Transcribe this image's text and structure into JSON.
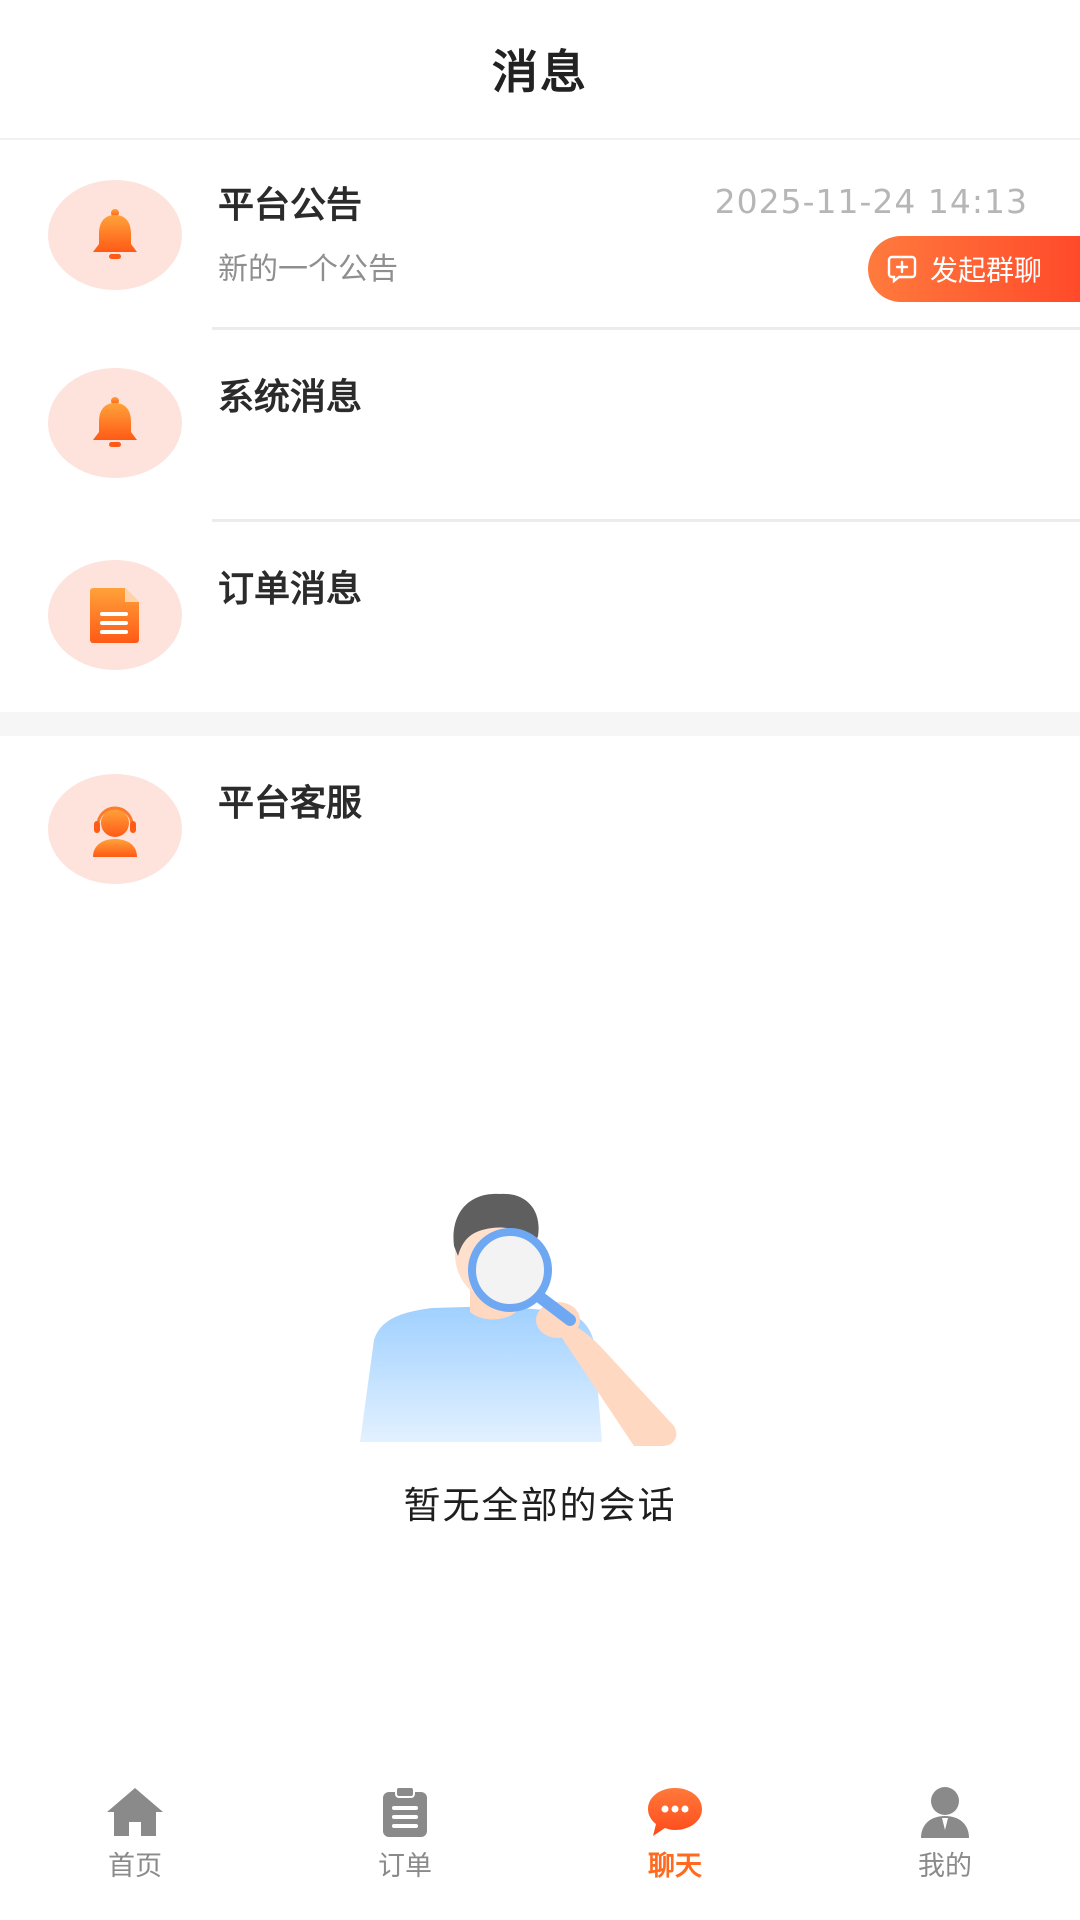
{
  "header": {
    "title": "消息"
  },
  "messages": [
    {
      "title": "平台公告",
      "subtitle": "新的一个公告",
      "time": "2025-11-24 14:13",
      "icon": "bell-icon"
    },
    {
      "title": "系统消息",
      "icon": "bell-icon"
    },
    {
      "title": "订单消息",
      "icon": "document-icon"
    }
  ],
  "service": {
    "title": "平台客服",
    "icon": "customer-service-icon"
  },
  "group_chat": {
    "label": "发起群聊",
    "icon": "add-chat-icon"
  },
  "empty_state": {
    "text": "暂无全部的会话"
  },
  "tabbar": {
    "items": [
      {
        "label": "首页",
        "icon": "home-icon"
      },
      {
        "label": "订单",
        "icon": "clipboard-icon"
      },
      {
        "label": "聊天",
        "icon": "chat-bubble-icon",
        "active": true
      },
      {
        "label": "我的",
        "icon": "user-icon"
      }
    ]
  },
  "colors": {
    "accent": "#ff6a1f",
    "avatar_bg": "#fde3dc",
    "inactive": "#8a8a8a"
  }
}
